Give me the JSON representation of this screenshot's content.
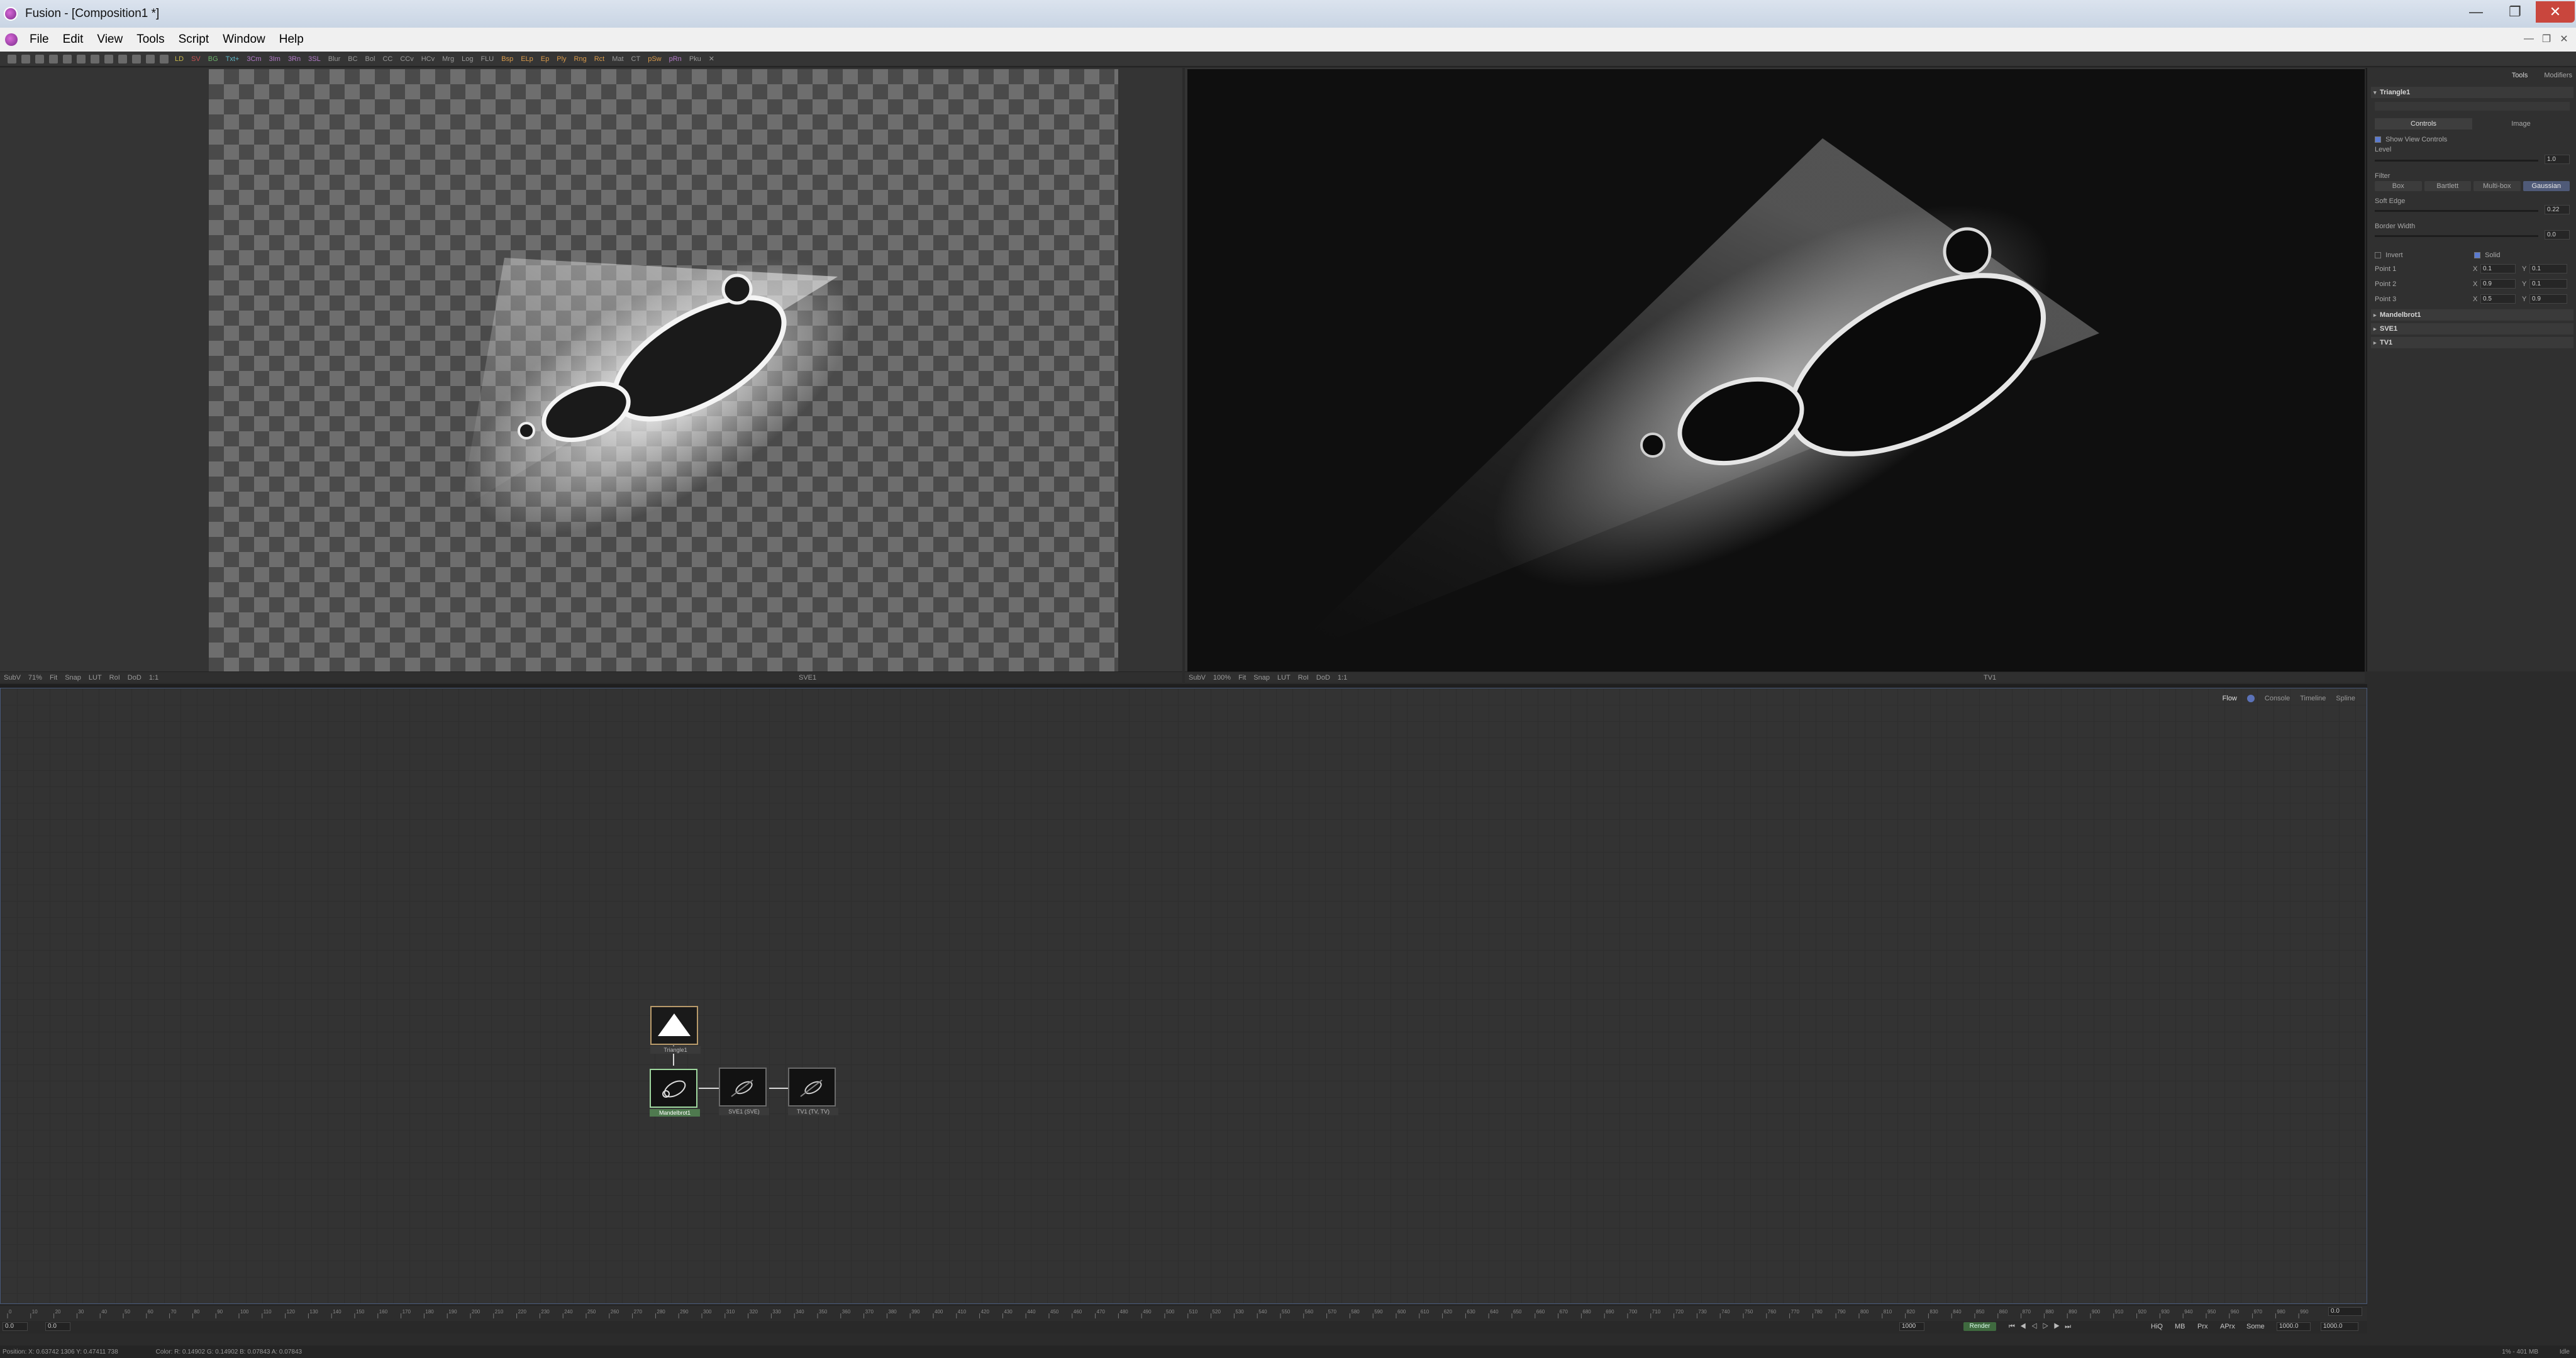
{
  "window": {
    "title": "Fusion - [Composition1 *]",
    "min_glyph": "—",
    "max_glyph": "❐",
    "close_glyph": "✕"
  },
  "menu": [
    "File",
    "Edit",
    "View",
    "Tools",
    "Script",
    "Window",
    "Help"
  ],
  "toolbar": {
    "tools": [
      "LD",
      "SV",
      "BG",
      "Txt+",
      "3Cm",
      "3Im",
      "3Rn",
      "3SL",
      "Blur",
      "BC",
      "Bol",
      "CC",
      "CCv",
      "HCv",
      "Mrg",
      "Log",
      "FLU",
      "Bsp",
      "ELp",
      "Ep",
      "Ply",
      "Rng",
      "Rct",
      "Mat",
      "CT",
      "pSw",
      "pRn",
      "Pku"
    ]
  },
  "viewer_left": {
    "name": "SVE1",
    "status": [
      "SubV",
      "71%",
      "Fit",
      "Snap",
      "LUT",
      "RoI",
      "DoD",
      "1:1"
    ]
  },
  "viewer_right": {
    "name": "TV1",
    "status": [
      "SubV",
      "100%",
      "Fit",
      "Snap",
      "LUT",
      "RoI",
      "DoD",
      "1:1"
    ]
  },
  "inspector": {
    "tabs": [
      "Tools",
      "Modifiers"
    ],
    "tool_name": "Triangle1",
    "subtabs": [
      "Controls",
      "Image"
    ],
    "show_view_controls": "Show View Controls",
    "level_label": "Level",
    "level_value": "1.0",
    "filter_label": "Filter",
    "filters": [
      "Box",
      "Bartlett",
      "Multi-box",
      "Gaussian"
    ],
    "soft_edge_label": "Soft Edge",
    "soft_edge_value": "0.22",
    "border_width_label": "Border Width",
    "border_width_value": "0.0",
    "invert_label": "Invert",
    "solid_label": "Solid",
    "points": [
      {
        "label": "Point 1",
        "x": "0.1",
        "y": "0.1"
      },
      {
        "label": "Point 2",
        "x": "0.9",
        "y": "0.1"
      },
      {
        "label": "Point 3",
        "x": "0.5",
        "y": "0.9"
      }
    ],
    "x_label": "X",
    "y_label": "Y",
    "collapsed_tools": [
      "Mandelbrot1",
      "SVE1",
      "TV1"
    ]
  },
  "flow": {
    "tabs": [
      "Flow",
      "Console",
      "Timeline",
      "Spline"
    ],
    "nodes": {
      "mask": "Triangle1",
      "mandel": "Mandelbrot1",
      "sve": "SVE1 (SVE)",
      "tv": "TV1 (TV, TV)"
    }
  },
  "timeline": {
    "ruler_labels": [
      "0",
      "10",
      "20",
      "30",
      "40",
      "50",
      "60",
      "70",
      "80",
      "90",
      "100",
      "110",
      "120",
      "130",
      "140",
      "150",
      "160",
      "170",
      "180",
      "190",
      "200",
      "210",
      "220",
      "230",
      "240",
      "250",
      "260",
      "270",
      "280",
      "290",
      "300",
      "310",
      "320",
      "330",
      "340",
      "350",
      "360",
      "370",
      "380",
      "390",
      "400",
      "410",
      "420",
      "430",
      "440",
      "450",
      "460",
      "470",
      "480",
      "490",
      "500",
      "510",
      "520",
      "530",
      "540",
      "550",
      "560",
      "570",
      "580",
      "590",
      "600",
      "610",
      "620",
      "630",
      "640",
      "650",
      "660",
      "670",
      "680",
      "690",
      "700",
      "710",
      "720",
      "730",
      "740",
      "750",
      "760",
      "770",
      "780",
      "790",
      "800",
      "810",
      "820",
      "830",
      "840",
      "850",
      "860",
      "870",
      "880",
      "890",
      "900",
      "910",
      "920",
      "930",
      "940",
      "950",
      "960",
      "970",
      "980",
      "990"
    ],
    "start": "0.0",
    "current": "0.0",
    "render_end": "1000",
    "render_label": "Render",
    "hiq": "HiQ",
    "mb": "MB",
    "prx": "Prx",
    "aprx": "APrx",
    "some": "Some",
    "end1": "1000.0",
    "end2": "1000.0",
    "right_value": "0.0"
  },
  "status": {
    "position": "Position:  X: 0.63742   1306   Y: 0.47411   738",
    "color": "Color:  R: 0.14902    G: 0.14902    B: 0.07843    A: 0.07843",
    "memory": "1% - 401 MB",
    "idle": "Idle"
  }
}
